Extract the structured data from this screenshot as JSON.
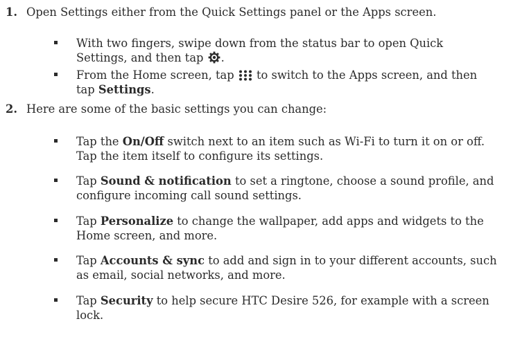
{
  "steps": [
    {
      "number": "1.",
      "text": "Open Settings either from the Quick Settings panel or the Apps screen.",
      "bullets": [
        {
          "a": "With two fingers, swipe down from the status bar to open Quick",
          "b": "Settings, and then tap",
          "icon": "gear-icon",
          "c": "."
        },
        {
          "a": "From the Home screen, tap",
          "icon": "apps-grid-icon",
          "b": "to switch to the Apps screen, and then",
          "c": "tap",
          "bold": "Settings",
          "d": "."
        }
      ]
    },
    {
      "number": "2.",
      "text": "Here are some of the basic settings you can change:",
      "bullets": [
        {
          "pre": "Tap the",
          "bold": "On/Off",
          "post": "switch next to an item such as Wi-Fi to turn it on or off.",
          "line2": "Tap the item itself to configure its settings."
        },
        {
          "pre": "Tap",
          "bold": "Sound & notification",
          "post": "to set a ringtone, choose a sound profile, and",
          "line2": "configure incoming call sound settings."
        },
        {
          "pre": "Tap",
          "bold": "Personalize",
          "post": "to change the wallpaper, add apps and widgets to the",
          "line2": "Home screen, and more."
        },
        {
          "pre": "Tap",
          "bold": "Accounts & sync",
          "post": "to add and sign in to your different accounts, such",
          "line2": "as email, social networks, and more."
        },
        {
          "pre": "Tap",
          "bold": "Security",
          "post": "to help secure HTC Desire 526, for example with a screen",
          "line2": "lock."
        }
      ]
    }
  ]
}
